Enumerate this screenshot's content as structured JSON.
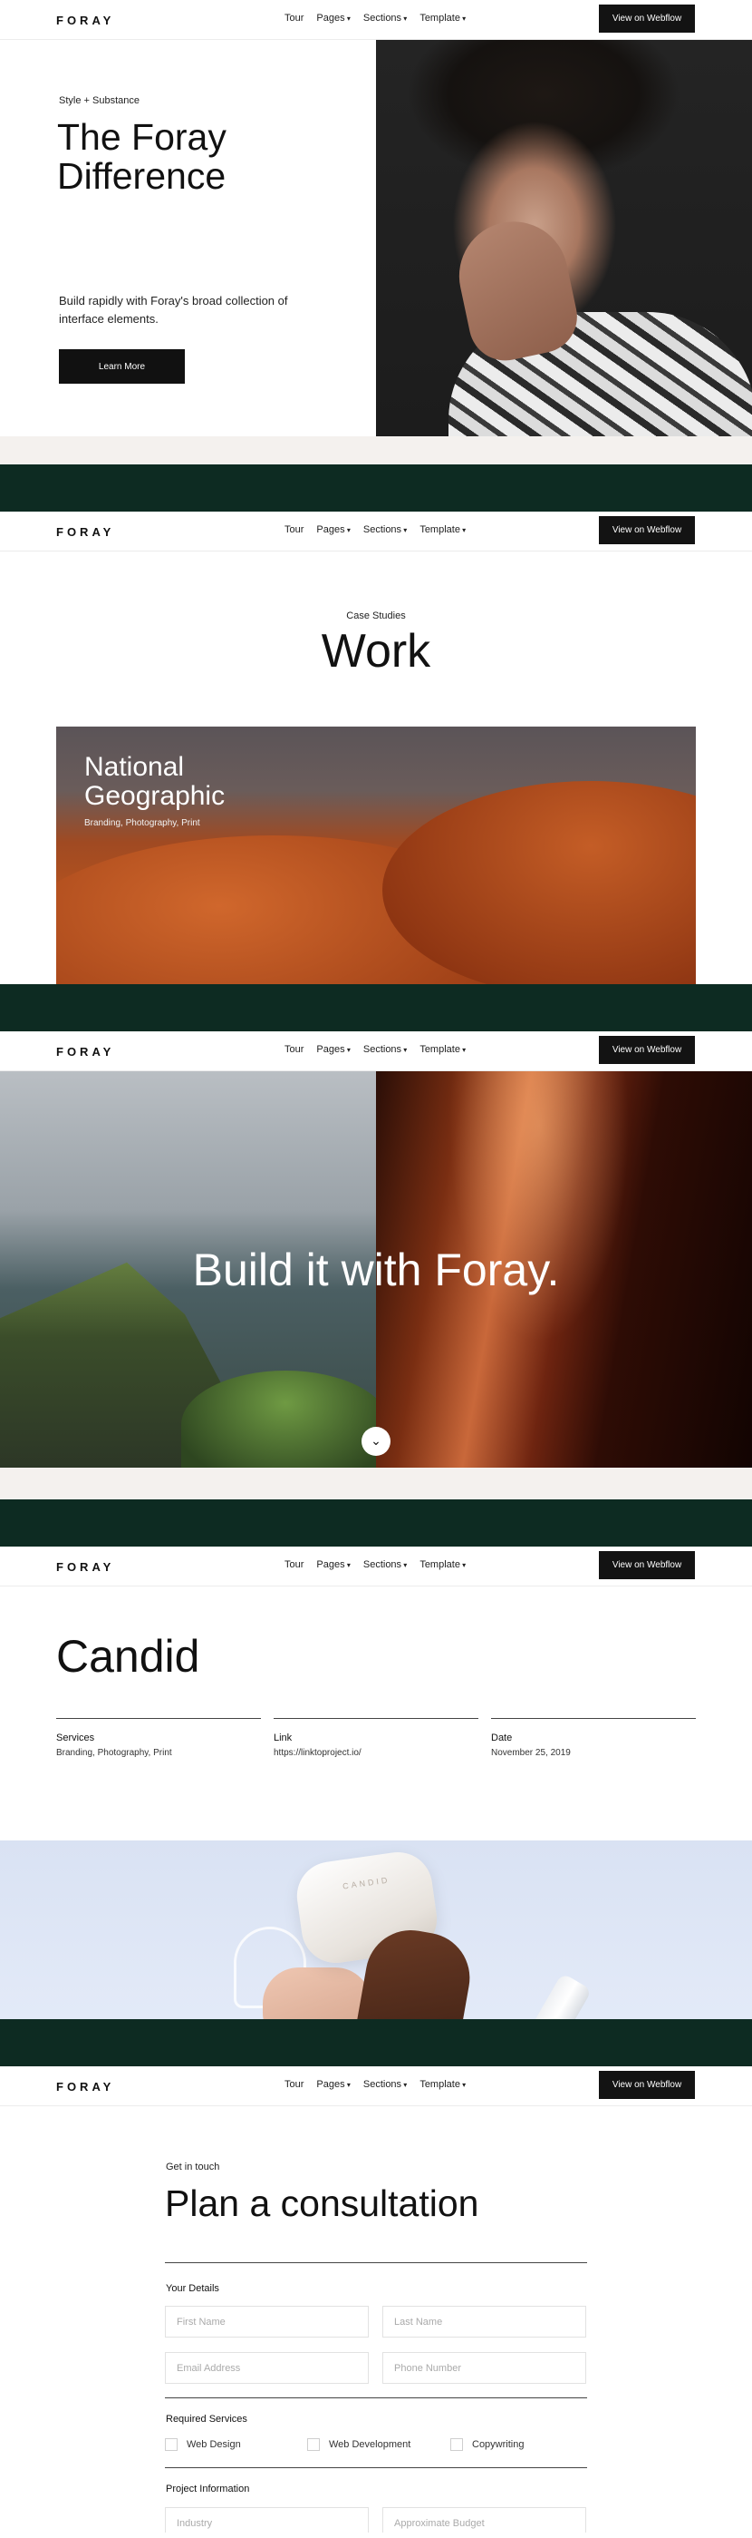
{
  "nav": {
    "logo": "FORAY",
    "links": [
      "Tour",
      "Pages",
      "Sections",
      "Template"
    ],
    "cta": "View on Webflow"
  },
  "hero": {
    "eyebrow": "Style + Substance",
    "title": "The Foray Difference",
    "description": "Build rapidly with Foray's broad collection of interface elements.",
    "button": "Learn More"
  },
  "work": {
    "eyebrow": "Case Studies",
    "title": "Work",
    "card_title": "National Geographic",
    "card_tags": "Branding, Photography, Print"
  },
  "build": {
    "headline": "Build it with Foray."
  },
  "candid": {
    "title": "Candid",
    "details": [
      {
        "label": "Services",
        "value": "Branding, Photography, Print"
      },
      {
        "label": "Link",
        "value": "https://linktoproject.io/"
      },
      {
        "label": "Date",
        "value": "November 25, 2019"
      }
    ],
    "brand_text": "CANDID"
  },
  "contact": {
    "eyebrow": "Get in touch",
    "title": "Plan a consultation",
    "your_details": "Your Details",
    "placeholders": {
      "first_name": "First Name",
      "last_name": "Last Name",
      "email": "Email Address",
      "phone": "Phone Number",
      "industry": "Industry",
      "budget": "Approximate Budget"
    },
    "required_services": "Required Services",
    "services": [
      "Web Design",
      "Web Development",
      "Copywriting"
    ],
    "project_information": "Project Information"
  }
}
